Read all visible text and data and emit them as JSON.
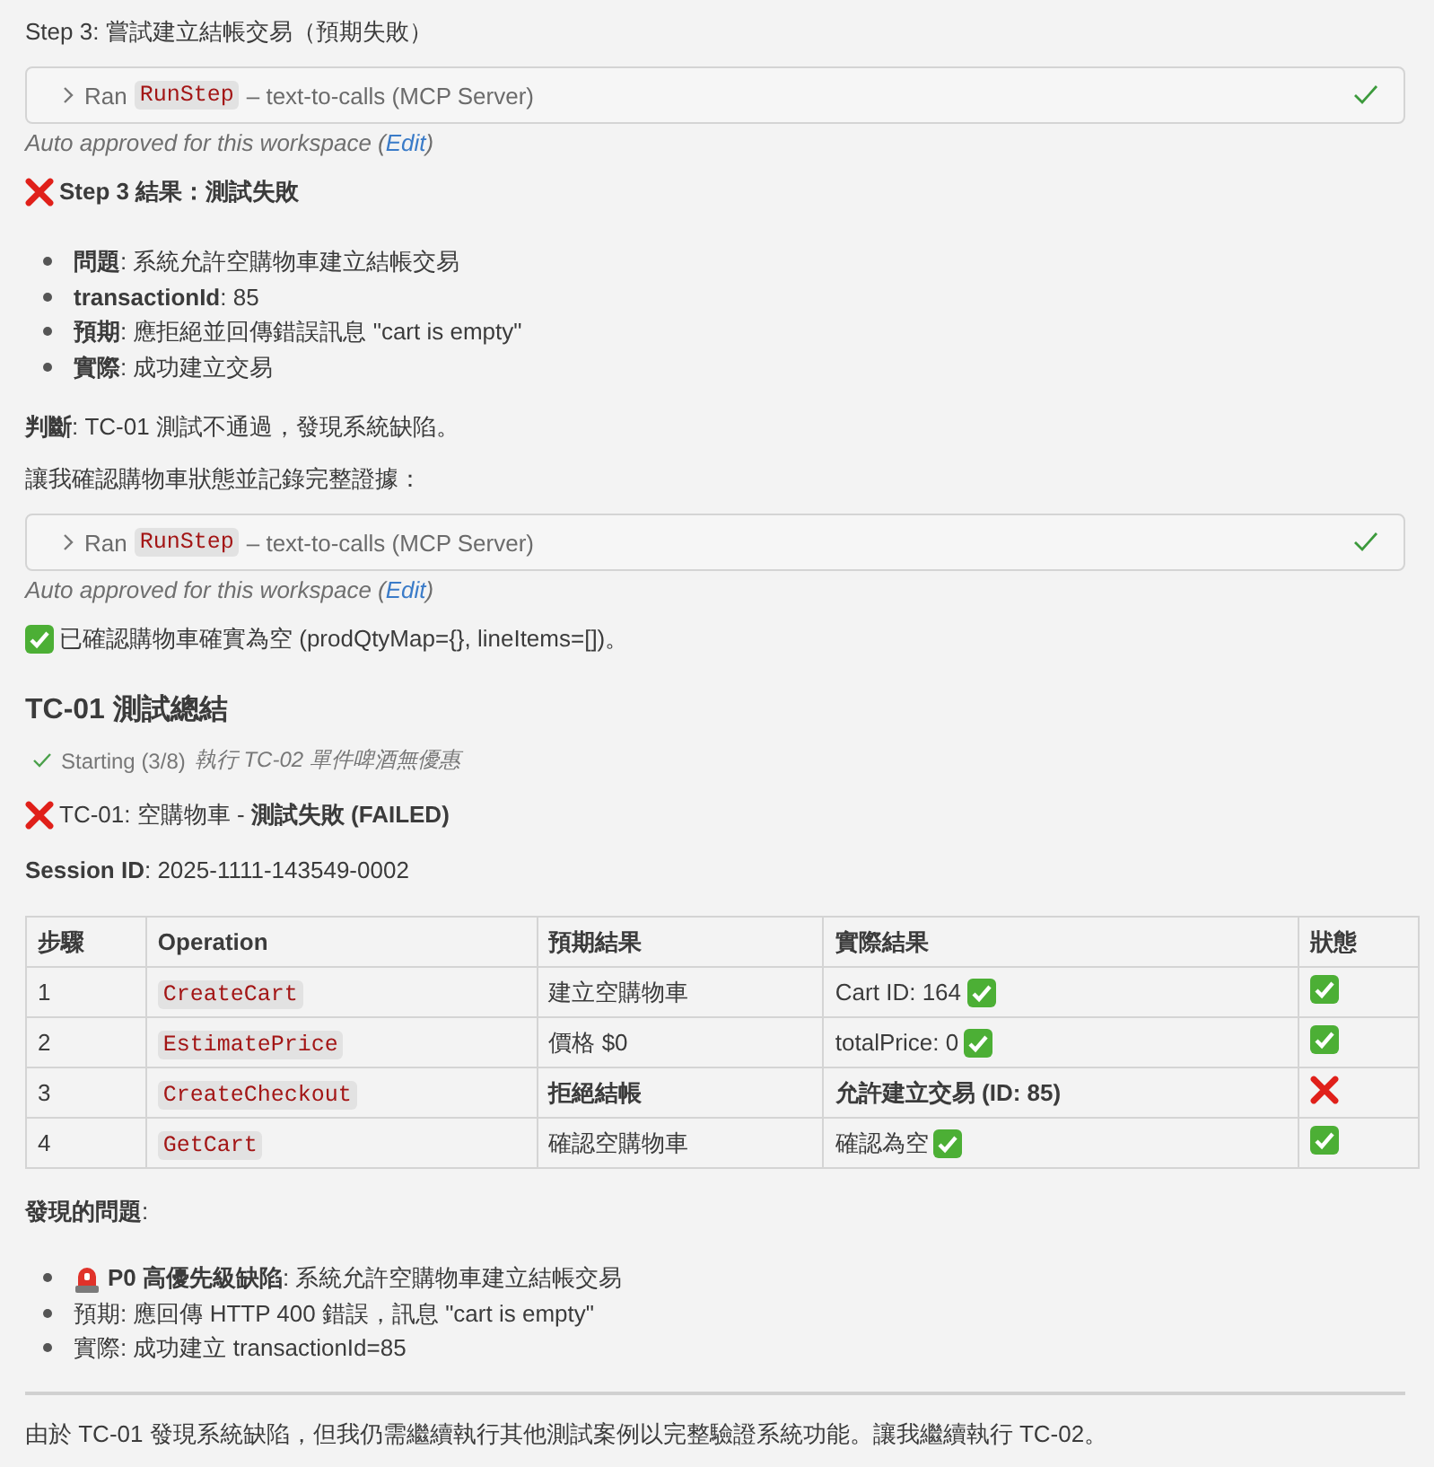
{
  "blocks": [
    {
      "kind": "text",
      "text": "Step 3: 嘗試建立結帳交易（預期失敗）"
    },
    {
      "kind": "tool_call",
      "verb": "Ran",
      "tool": "RunStep",
      "detail": "– text-to-calls (MCP Server)",
      "done": true,
      "approval_prefix": "Auto approved for this workspace (",
      "approval_link": "Edit",
      "approval_suffix": ")"
    },
    {
      "kind": "status_line",
      "passed": false,
      "bold": true,
      "text": "Step 3 結果：測試失敗"
    },
    {
      "kind": "bullets",
      "items": [
        {
          "kind": "plain",
          "text": "**問題**: 系統允許空購物車建立結帳交易"
        },
        {
          "kind": "plain",
          "text": "**transactionId**: 85"
        },
        {
          "kind": "plain",
          "text": "**預期**: 應拒絕並回傳錯誤訊息 \"cart is empty\""
        },
        {
          "kind": "plain",
          "text": "**實際**: 成功建立交易"
        }
      ]
    },
    {
      "kind": "text",
      "text": "**判斷**: TC-01 測試不通過，發現系統缺陷。"
    },
    {
      "kind": "text",
      "text": "讓我確認購物車狀態並記錄完整證據："
    },
    {
      "kind": "tool_call",
      "verb": "Ran",
      "tool": "RunStep",
      "detail": "– text-to-calls (MCP Server)",
      "done": true,
      "approval_prefix": "Auto approved for this workspace (",
      "approval_link": "Edit",
      "approval_suffix": ")"
    },
    {
      "kind": "status_line",
      "passed": true,
      "bold": false,
      "text": "已確認購物車確實為空 (prodQtyMap={}, lineItems=[])。"
    },
    {
      "kind": "heading",
      "text": "TC-01 測試總結"
    },
    {
      "kind": "progress",
      "done": true,
      "text": "Starting (3/8)",
      "detail": "執行 TC-02 單件啤酒無優惠"
    },
    {
      "kind": "status_line",
      "passed": false,
      "bold": false,
      "text": "TC-01: 空購物車 - **測試失敗 (FAILED)**"
    },
    {
      "kind": "text",
      "text": "**Session ID**: 2025-1111-143549-0002"
    },
    {
      "kind": "table",
      "columns": [
        "步驟",
        "Operation",
        "預期結果",
        "實際結果",
        "狀態"
      ],
      "rows": [
        {
          "step": "1",
          "operation": "CreateCart",
          "expected": "建立空購物車",
          "actual": "Cart ID: 164",
          "actual_check": true,
          "passed": true,
          "emphasis": false
        },
        {
          "step": "2",
          "operation": "EstimatePrice",
          "expected": "價格 $0",
          "actual": "totalPrice: 0",
          "actual_check": true,
          "passed": true,
          "emphasis": false
        },
        {
          "step": "3",
          "operation": "CreateCheckout",
          "expected": "拒絕結帳",
          "actual": "允許建立交易 (ID: 85)",
          "actual_check": false,
          "passed": false,
          "emphasis": true
        },
        {
          "step": "4",
          "operation": "GetCart",
          "expected": "確認空購物車",
          "actual": "確認為空",
          "actual_check": true,
          "passed": true,
          "emphasis": false
        }
      ]
    },
    {
      "kind": "text",
      "text": "**發現的問題**:"
    },
    {
      "kind": "bullets",
      "items": [
        {
          "kind": "alert",
          "text": "**P0 高優先級缺陷**: 系統允許空購物車建立結帳交易"
        },
        {
          "kind": "plain",
          "text": "預期: 應回傳 HTTP 400 錯誤，訊息 \"cart is empty\""
        },
        {
          "kind": "plain",
          "text": "實際: 成功建立 transactionId=85"
        }
      ]
    },
    {
      "kind": "rule"
    },
    {
      "kind": "text",
      "text": "由於 TC-01 發現系統缺陷，但我仍需繼續執行其他測試案例以完整驗證系統功能。讓我繼續執行 TC-02。"
    }
  ]
}
